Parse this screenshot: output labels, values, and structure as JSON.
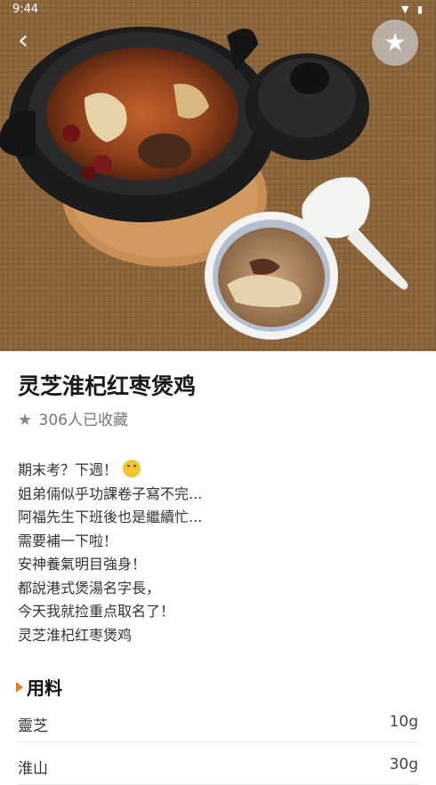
{
  "status_bar": {
    "time": "9:44",
    "icons": "▼ ▮"
  },
  "nav": {
    "back_icon": "chevron-left-icon",
    "favorite_icon": "star-icon"
  },
  "recipe": {
    "title": "灵芝淮杞红枣煲鸡",
    "favorites": "306人已收藏",
    "description": [
      "期末考？下週！",
      "姐弟倆似乎功課卷子寫不完...",
      "阿福先生下班後也是繼續忙...",
      "需要補一下啦！",
      "安神養氣明目強身！",
      "都說港式煲湯名字長，",
      "今天我就捡重点取名了！",
      "灵芝淮杞红枣煲鸡"
    ]
  },
  "ingredients": {
    "heading": "用料",
    "items": [
      {
        "name": "靈芝",
        "amount": "10g"
      },
      {
        "name": "淮山",
        "amount": "30g"
      }
    ]
  }
}
